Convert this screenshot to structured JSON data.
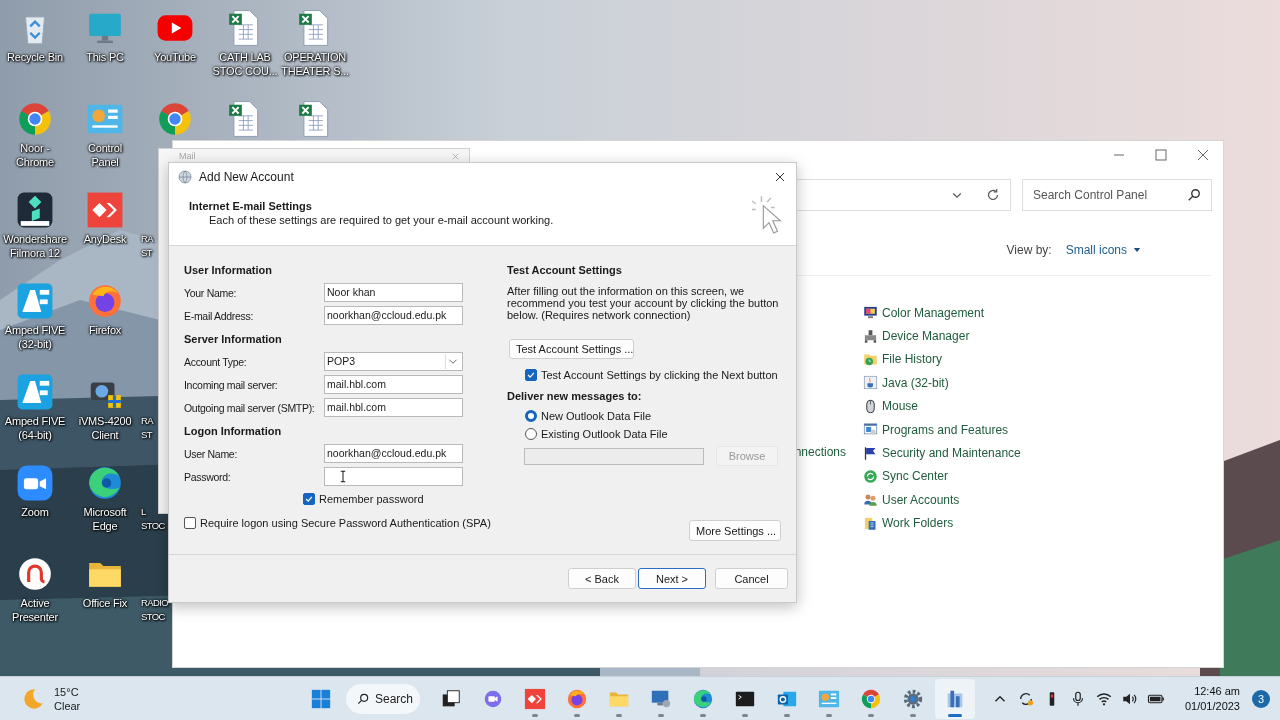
{
  "desktop": {
    "columns": [
      [
        {
          "kind": "bin",
          "label": "Recycle Bin"
        },
        {
          "kind": "chrome",
          "label": "Noor -\nChrome"
        },
        {
          "kind": "filmora",
          "label": "Wondershare\nFilmora 12"
        },
        {
          "kind": "af",
          "label": "Amped FIVE\n(32-bit)"
        },
        {
          "kind": "af",
          "label": "Amped FIVE\n(64-bit)"
        },
        {
          "kind": "zoom",
          "label": "Zoom"
        },
        {
          "kind": "active",
          "label": "Active\nPresenter"
        }
      ],
      [
        {
          "kind": "pc",
          "label": "This PC"
        },
        {
          "kind": "control",
          "label": "Control\nPanel"
        },
        {
          "kind": "anydesk",
          "label": "AnyDesk"
        },
        {
          "kind": "firefox",
          "label": "Firefox"
        },
        {
          "kind": "ivms",
          "label": "iVMS-4200\nClient"
        },
        {
          "kind": "edge",
          "label": "Microsoft\nEdge"
        },
        {
          "kind": "folder",
          "label": "Office Fix"
        }
      ],
      [
        {
          "kind": "youtube",
          "label": "YouTube"
        },
        {
          "kind": "chrome"
        },
        {
          "kind": "label-only",
          "label": "RA\nST"
        },
        {
          "kind": "empty"
        },
        {
          "kind": "label-only",
          "label": "RA\nST"
        },
        {
          "kind": "label-only",
          "label": "L\nSTOC"
        },
        {
          "kind": "label-only",
          "label": "RADIO\nSTOC"
        }
      ],
      [
        {
          "kind": "excel",
          "label": "CATH LAB\nSTOC COU..."
        },
        {
          "kind": "excel"
        }
      ],
      [
        {
          "kind": "excel",
          "label": "OPERATION\nTHEATER S..."
        },
        {
          "kind": "excel"
        }
      ]
    ]
  },
  "control_panel": {
    "search": {
      "placeholder": "Search Control Panel"
    },
    "view_by": {
      "label": "View by:",
      "value": "Small icons"
    },
    "partial_item": "nnections",
    "items": [
      {
        "kind": "color",
        "label": "Color Management"
      },
      {
        "kind": "device",
        "label": "Device Manager"
      },
      {
        "kind": "history",
        "label": "File History"
      },
      {
        "kind": "java",
        "label": "Java (32-bit)"
      },
      {
        "kind": "mouse",
        "label": "Mouse"
      },
      {
        "kind": "programs",
        "label": "Programs and Features"
      },
      {
        "kind": "security",
        "label": "Security and Maintenance"
      },
      {
        "kind": "sync",
        "label": "Sync Center"
      },
      {
        "kind": "users",
        "label": "User Accounts"
      },
      {
        "kind": "workfolders",
        "label": "Work Folders"
      }
    ]
  },
  "mail_window": {
    "title": "Mail"
  },
  "dialog": {
    "title": "Add New Account",
    "heading": "Internet E-mail Settings",
    "subheading": "Each of these settings are required to get your e-mail account working.",
    "sections": [
      {
        "title": "User Information",
        "fields": [
          {
            "kind": "text",
            "label": "Your Name:",
            "value": "Noor khan"
          },
          {
            "kind": "text",
            "label": "E-mail Address:",
            "value": "noorkhan@ccloud.edu.pk"
          }
        ]
      },
      {
        "title": "Server Information",
        "fields": [
          {
            "kind": "select",
            "label": "Account Type:",
            "value": "POP3"
          },
          {
            "kind": "text",
            "label": "Incoming mail server:",
            "value": "mail.hbl.com"
          },
          {
            "kind": "text",
            "label": "Outgoing mail server (SMTP):",
            "value": "mail.hbl.com"
          }
        ]
      },
      {
        "title": "Logon Information",
        "fields": [
          {
            "kind": "text",
            "label": "User Name:",
            "value": "noorkhan@ccloud.edu.pk"
          },
          {
            "kind": "password",
            "label": "Password:"
          }
        ]
      }
    ],
    "remember": {
      "label": "Remember password",
      "checked": true
    },
    "spa": {
      "label": "Require logon using Secure Password Authentication (SPA)",
      "checked": false
    },
    "test": {
      "title": "Test Account Settings",
      "text": "After filling out the information on this screen, we recommend you test your account by clicking the button below. (Requires network connection)",
      "button": "Test Account Settings ...",
      "auto": {
        "label": "Test Account Settings by clicking the Next button",
        "checked": true
      }
    },
    "deliver": {
      "title": "Deliver new messages to:",
      "options": [
        {
          "label": "New Outlook Data File",
          "selected": true
        },
        {
          "label": "Existing Outlook Data File",
          "selected": false
        }
      ],
      "browse": {
        "label": "Browse",
        "disabled": true
      }
    },
    "more": "More Settings ...",
    "buttons": [
      {
        "label": "< Back",
        "default": false
      },
      {
        "label": "Next >",
        "default": true
      },
      {
        "label": "Cancel",
        "default": false
      }
    ]
  },
  "taskbar": {
    "weather": {
      "temp": "15°C",
      "condition": "Clear"
    },
    "search": "Search",
    "apps": [
      {
        "kind": "taskview",
        "running": false,
        "selected": false
      },
      {
        "kind": "chat",
        "running": false,
        "selected": false
      },
      {
        "kind": "anydesk",
        "running": true,
        "selected": false
      },
      {
        "kind": "firefox",
        "running": true,
        "selected": false
      },
      {
        "kind": "folder",
        "running": true,
        "selected": false
      },
      {
        "kind": "remote",
        "running": true,
        "selected": false
      },
      {
        "kind": "edge",
        "running": true,
        "selected": false
      },
      {
        "kind": "terminal",
        "running": true,
        "selected": false
      },
      {
        "kind": "outlook",
        "running": true,
        "selected": false
      },
      {
        "kind": "control",
        "running": true,
        "selected": false
      },
      {
        "kind": "chrome",
        "running": true,
        "selected": false
      },
      {
        "kind": "gear",
        "running": true,
        "selected": false
      },
      {
        "kind": "app",
        "running": true,
        "selected": true
      }
    ],
    "clock": {
      "time": "12:46 am",
      "date": "01/01/2023"
    },
    "notifications": "3"
  }
}
